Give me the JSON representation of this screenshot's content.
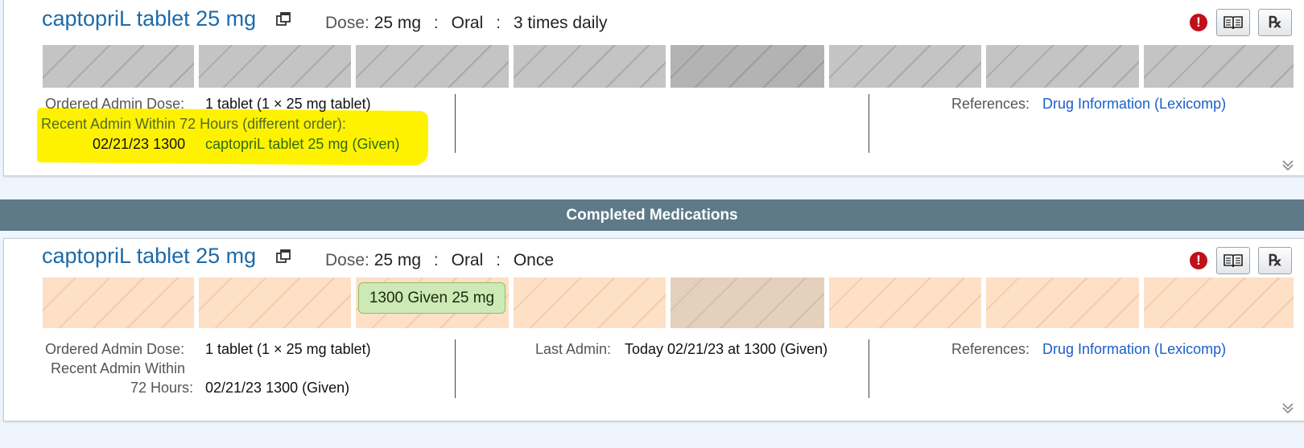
{
  "section_header": "Completed Medications",
  "cards": [
    {
      "title": "captopriL tablet 25 mg",
      "dose_label": "Dose:",
      "dose_value": "25 mg",
      "route": "Oral",
      "frequency": "3 times daily",
      "ordered_dose_label": "Ordered Admin Dose:",
      "ordered_dose_value": "1 tablet (1 × 25 mg tablet)",
      "recent_admin_label": "Recent Admin Within 72 Hours (different order):",
      "recent_admin_datetime": "02/21/23 1300",
      "recent_admin_med": "captopriL tablet 25 mg (Given)",
      "references_label": "References:",
      "references_link": "Drug Information (Lexicomp)"
    },
    {
      "title": "captopriL tablet 25 mg",
      "dose_label": "Dose:",
      "dose_value": "25 mg",
      "route": "Oral",
      "frequency": "Once",
      "admin_chip": "1300 Given 25 mg",
      "ordered_dose_label": "Ordered Admin Dose:",
      "ordered_dose_value": "1 tablet (1 × 25 mg tablet)",
      "recent_admin_label_1": "Recent Admin Within",
      "recent_admin_label_2": "72 Hours:",
      "recent_admin_value": "02/21/23 1300 (Given)",
      "last_admin_label": "Last Admin:",
      "last_admin_value": "Today 02/21/23 at 1300 (Given)",
      "references_label": "References:",
      "references_link": "Drug Information (Lexicomp)"
    }
  ],
  "icons": {
    "external": "external-link-icon",
    "alert": "alert-icon",
    "book": "book-icon",
    "rx": "rx-icon",
    "expand": "double-chevron-down-icon"
  },
  "colors": {
    "title_blue": "#1d6aa8",
    "link_blue": "#1c5ec9",
    "section_bar": "#5e7a88",
    "alert_red": "#c0101a",
    "highlight_yellow": "#fff200",
    "given_chip": "#cde9b5"
  }
}
